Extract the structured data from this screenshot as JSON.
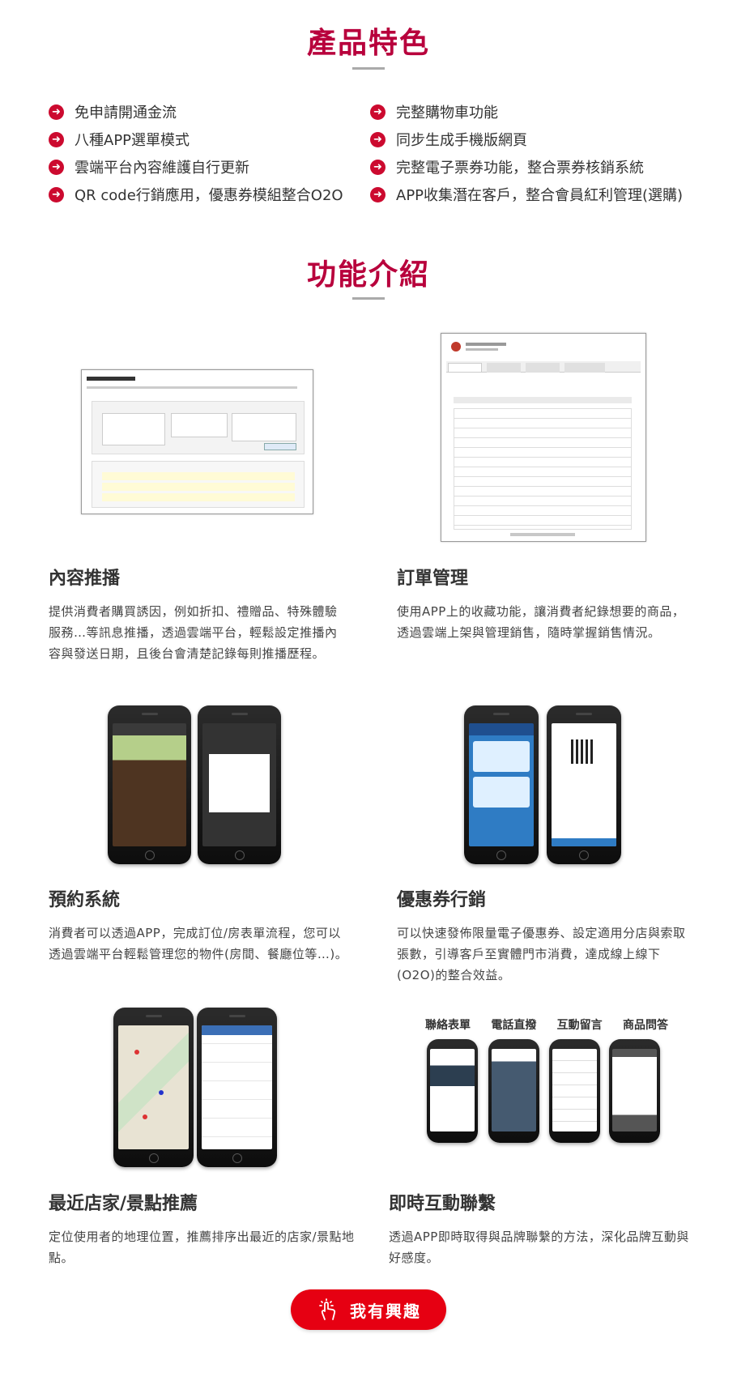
{
  "features_section": {
    "title": "產品特色",
    "left": [
      "免申請開通金流",
      "八種APP選單模式",
      "雲端平台內容維護自行更新",
      "QR code行銷應用，優惠券模組整合O2O"
    ],
    "right": [
      "完整購物車功能",
      "同步生成手機版網頁",
      "完整電子票券功能，整合票券核銷系統",
      "APP收集潛在客戶，整合會員紅利管理(選購)"
    ]
  },
  "functions_section": {
    "title": "功能介紹",
    "items": [
      {
        "title": "內容推播",
        "desc": "提供消費者購買誘因，例如折扣、禮贈品、特殊體驗服務…等訊息推播，透過雲端平台，輕鬆設定推播內容與發送日期，且後台會清楚記錄每則推播歷程。"
      },
      {
        "title": "訂單管理",
        "desc": "使用APP上的收藏功能，讓消費者紀錄想要的商品，透過雲端上架與管理銷售，隨時掌握銷售情況。"
      },
      {
        "title": "預約系統",
        "desc": "消費者可以透過APP，完成訂位/房表單流程，您可以透過雲端平台輕鬆管理您的物件(房間、餐廳位等…)。"
      },
      {
        "title": "優惠券行銷",
        "desc": "可以快速發佈限量電子優惠券、設定適用分店與索取張數，引導客戶至實體門市消費，達成線上線下(O2O)的整合效益。"
      },
      {
        "title": "最近店家/景點推薦",
        "desc": "定位使用者的地理位置，推薦排序出最近的店家/景點地點。"
      },
      {
        "title": "即時互動聯繫",
        "desc": "透過APP即時取得與品牌聯繫的方法，深化品牌互動與好感度。"
      }
    ],
    "interaction_labels": [
      "聯絡表單",
      "電話直撥",
      "互動留言",
      "商品問答"
    ]
  },
  "cta": {
    "label": "我有興趣",
    "icon": "hand-pointer-icon",
    "color": "#e60012"
  },
  "colors": {
    "accent": "#b8003c",
    "bullet": "#cc0a2f"
  }
}
